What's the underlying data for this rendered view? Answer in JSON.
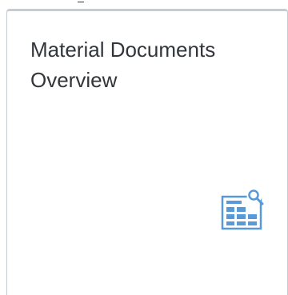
{
  "tile": {
    "title_line1": "Material Documents",
    "title_line2": "Overview",
    "icon": "table-search-icon",
    "icon_color": "#5899da",
    "border_color": "#c6ccd3",
    "text_color": "#32363a"
  }
}
